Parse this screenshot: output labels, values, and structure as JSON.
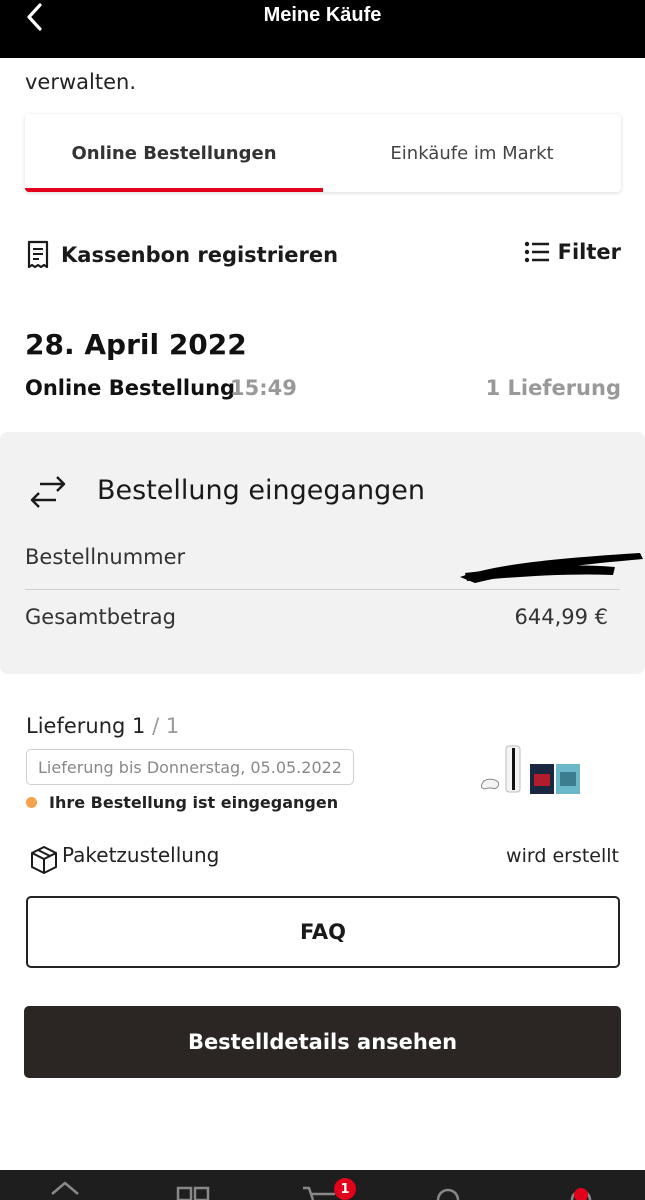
{
  "header": {
    "title": "Meine Käufe",
    "back_icon": "chevron-left-icon"
  },
  "intro_text": "verwalten.",
  "tabs": [
    {
      "label": "Online Bestellungen",
      "active": true
    },
    {
      "label": "Einkäufe im Markt",
      "active": false
    }
  ],
  "actions": {
    "receipt_label": "Kassenbon registrieren",
    "receipt_icon": "receipt-icon",
    "filter_label": "Filter",
    "filter_icon": "filter-list-icon"
  },
  "order": {
    "date": "28. April 2022",
    "type": "Online Bestellung",
    "time": "15:49",
    "deliveries_count": "1 Lieferung",
    "status_title": "Bestellung eingegangen",
    "status_icon": "arrows-exchange-icon",
    "order_number_label": "Bestellnummer",
    "order_number_value": "",
    "total_label": "Gesamtbetrag",
    "total_value": "644,99 €"
  },
  "delivery": {
    "label": "Lieferung 1",
    "of": "/ 1",
    "eta": "Lieferung bis Donnerstag, 05.05.2022",
    "status": "Ihre Bestellung ist eingegangen",
    "status_color": "#f5a24c",
    "shipping_label": "Paketzustellung",
    "shipping_icon": "package-icon",
    "shipping_value": "wird erstellt"
  },
  "buttons": {
    "faq": "FAQ",
    "details": "Bestelldetails ansehen"
  },
  "bottom_nav": {
    "items": [
      "home-icon",
      "categories-icon",
      "cart-icon",
      "search-icon",
      "account-icon"
    ],
    "cart_badge": "1"
  },
  "colors": {
    "accent": "#e2001a",
    "dark_button": "#2b2624"
  }
}
